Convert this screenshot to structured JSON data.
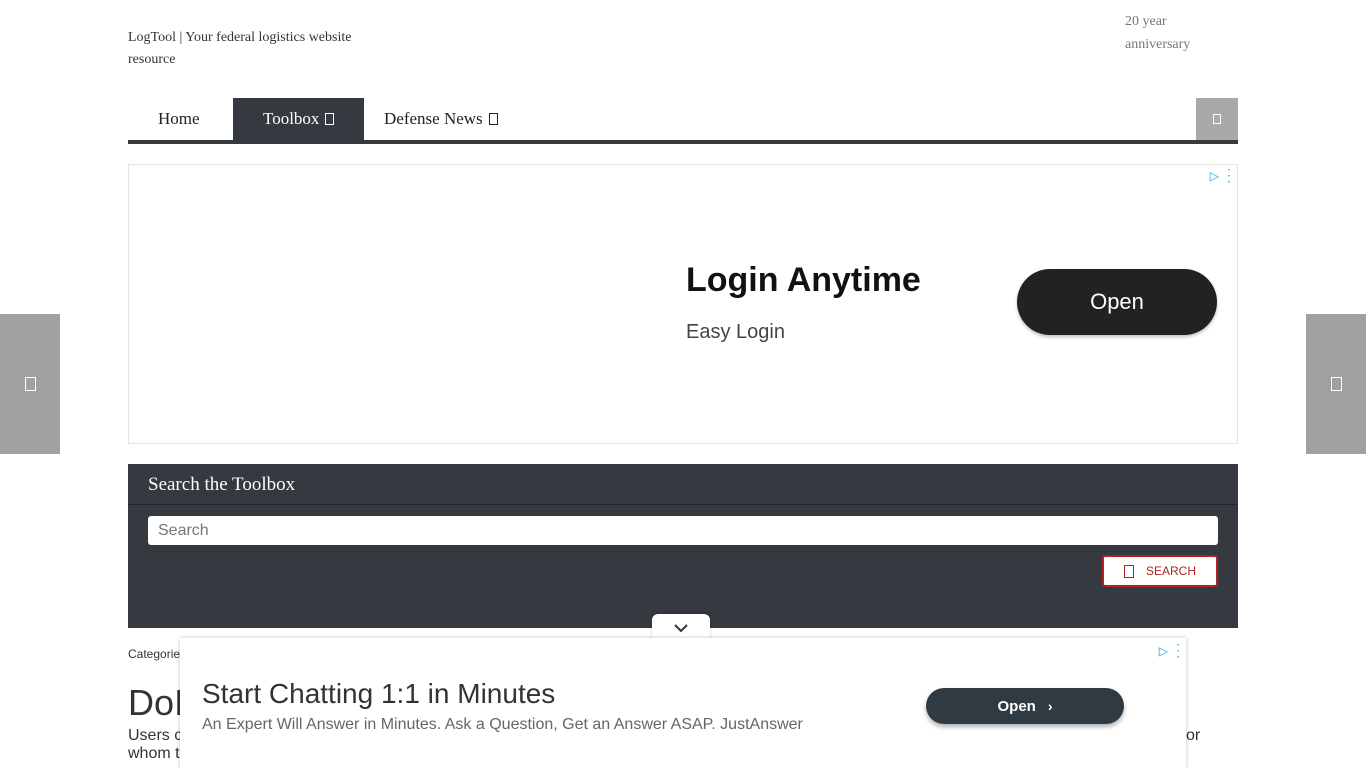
{
  "header": {
    "logo_alt": "LogTool | Your federal logistics website resource",
    "anniversary_alt": "20 year anniversary"
  },
  "nav": {
    "items": [
      {
        "label": "Home"
      },
      {
        "label": "Toolbox"
      },
      {
        "label": "Defense News"
      }
    ],
    "active": "Toolbox"
  },
  "ad_top": {
    "title": "Login Anytime",
    "subtitle": "Easy Login",
    "button": "Open"
  },
  "search": {
    "title": "Search the Toolbox",
    "placeholder": "Search",
    "button": "SEARCH"
  },
  "content": {
    "categories_label": "Categorie",
    "title_fragment": "DoI",
    "line1_start": "Users c",
    "line1_end": "or",
    "line2_start": "whom t"
  },
  "anchor_ad": {
    "title": "Start Chatting 1:1 in Minutes",
    "subtitle": "An Expert Will Answer in Minutes. Ask a Question, Get an Answer ASAP. JustAnswer",
    "button": "Open"
  },
  "colors": {
    "nav_dark": "#343a40",
    "search_button_red": "#b22222",
    "side_arrow_gray": "#a0a0a0",
    "adchoices_blue": "#1aa3d9"
  }
}
